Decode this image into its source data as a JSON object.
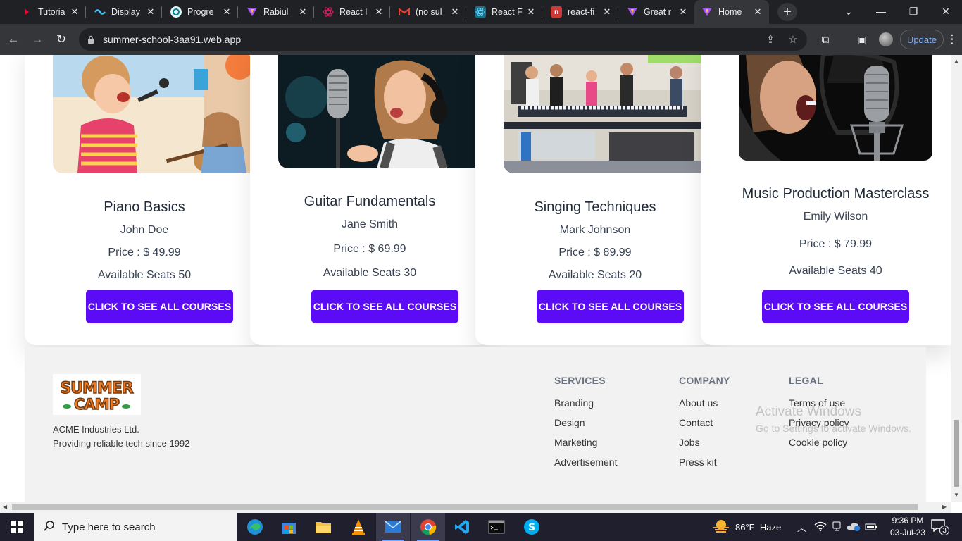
{
  "browser": {
    "tabs": [
      {
        "title": "Tutoria",
        "favicon": "youtube-icon",
        "color": "#ff0033"
      },
      {
        "title": "Display",
        "favicon": "wave-icon",
        "color": "#4fc3f7"
      },
      {
        "title": "Progre",
        "favicon": "progress-icon",
        "color": "#4dd0e1"
      },
      {
        "title": "Rabiul",
        "favicon": "vite-icon",
        "color": "#a855f7"
      },
      {
        "title": "React I",
        "favicon": "react-icon",
        "color": "#e91e63"
      },
      {
        "title": "(no sul",
        "favicon": "gmail-icon",
        "color": "#ea4335"
      },
      {
        "title": "React F",
        "favicon": "react-icon",
        "color": "#61dafb"
      },
      {
        "title": "react-fi",
        "favicon": "npm-icon",
        "color": "#cb3837"
      },
      {
        "title": "Great r",
        "favicon": "vite-icon",
        "color": "#a855f7"
      },
      {
        "title": "Home",
        "favicon": "vite-icon",
        "color": "#a855f7"
      }
    ],
    "active_tab_index": 9,
    "url": "summer-school-3aa91.web.app",
    "update_label": "Update"
  },
  "courses": [
    {
      "title": "Piano Basics",
      "instructor": "John Doe",
      "price": "Price : $ 49.99",
      "seats": "Available Seats 50",
      "cta": "CLICK TO SEE ALL COURSES"
    },
    {
      "title": "Guitar Fundamentals",
      "instructor": "Jane Smith",
      "price": "Price : $ 69.99",
      "seats": "Available Seats 30",
      "cta": "CLICK TO SEE ALL COURSES"
    },
    {
      "title": "Singing Techniques",
      "instructor": "Mark Johnson",
      "price": "Price : $ 89.99",
      "seats": "Available Seats 20",
      "cta": "CLICK TO SEE ALL COURSES"
    },
    {
      "title": "Music Production Masterclass",
      "instructor": "Emily Wilson",
      "price": "Price : $ 79.99",
      "seats": "Available Seats 40",
      "cta": "CLICK TO SEE ALL COURSES"
    }
  ],
  "footer": {
    "logo_text_line1": "SUMMER",
    "logo_text_line2": "CAMP",
    "company_name": "ACME Industries Ltd.",
    "tagline": "Providing reliable tech since 1992",
    "columns": [
      {
        "heading": "SERVICES",
        "links": [
          "Branding",
          "Design",
          "Marketing",
          "Advertisement"
        ]
      },
      {
        "heading": "COMPANY",
        "links": [
          "About us",
          "Contact",
          "Jobs",
          "Press kit"
        ]
      },
      {
        "heading": "LEGAL",
        "links": [
          "Terms of use",
          "Privacy policy",
          "Cookie policy"
        ]
      }
    ]
  },
  "watermark": {
    "line1": "Activate Windows",
    "line2": "Go to Settings to activate Windows."
  },
  "taskbar": {
    "search_placeholder": "Type here to search",
    "apps": [
      "edge-icon",
      "store-icon",
      "file-explorer-icon",
      "vlc-icon",
      "mail-icon",
      "chrome-icon",
      "vscode-icon",
      "terminal-icon",
      "skype-icon"
    ],
    "weather": "86°F  Haze",
    "time": "9:36 PM",
    "date": "03-Jul-23",
    "notification_count": "3"
  },
  "colors": {
    "cta": "#5b0bf5",
    "footer_bg": "#f2f2f2",
    "chrome_dark": "#202124"
  }
}
